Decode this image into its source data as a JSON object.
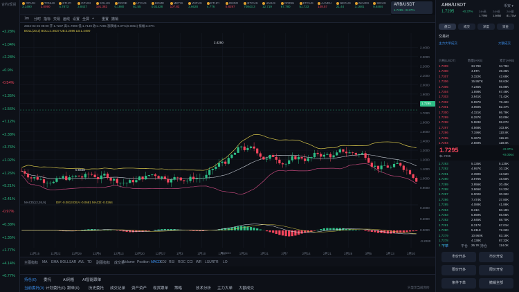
{
  "left_strip": {
    "header": "合约/现货",
    "percents": [
      {
        "v": "+2.28%",
        "dir": "up"
      },
      {
        "v": "+1.04%",
        "dir": "up"
      },
      {
        "v": "+2.28%",
        "dir": "up"
      },
      {
        "v": "+0.9%",
        "dir": "up"
      },
      {
        "v": "-0.54%",
        "dir": "dn"
      },
      {
        "v": "+1.35%",
        "dir": "up"
      },
      {
        "v": "+1.56%",
        "dir": "up"
      },
      {
        "v": "+7.12%",
        "dir": "up"
      },
      {
        "v": "+2.38%",
        "dir": "up"
      },
      {
        "v": "+3.76%",
        "dir": "up"
      },
      {
        "v": "+1.02%",
        "dir": "up"
      },
      {
        "v": "+1.26%",
        "dir": "up"
      },
      {
        "v": "+5.21%",
        "dir": "up"
      },
      {
        "v": "+2.41%",
        "dir": "up"
      },
      {
        "v": "-0.97%",
        "dir": "dn"
      },
      {
        "v": "+0.38%",
        "dir": "up"
      },
      {
        "v": "+1.35%",
        "dir": "up"
      },
      {
        "v": "+1.77%",
        "dir": "up"
      },
      {
        "v": "+4.14%",
        "dir": "up"
      },
      {
        "v": "+0.77%",
        "dir": "up"
      }
    ]
  },
  "tickers": [
    {
      "name": "OPUSI",
      "price": "3.1490",
      "chg": "+1.23",
      "dir": "up"
    },
    {
      "name": "TONUS",
      "price": "3.0090",
      "chg": "-0.4",
      "dir": "dn"
    },
    {
      "name": "ETHFI",
      "price": "4.7873",
      "chg": "7.2",
      "dir": "up"
    },
    {
      "name": "OPUSI",
      "price": "3.8427",
      "chg": "2.2",
      "dir": "up"
    },
    {
      "name": "SOLUS",
      "price": "191.382",
      "chg": "-1.2",
      "dir": "dn"
    },
    {
      "name": "DOGE",
      "price": "0.1980",
      "chg": "1.7",
      "dir": "up"
    },
    {
      "name": "LTCUS",
      "price": "81.55",
      "chg": "0.8",
      "dir": "up"
    },
    {
      "name": "BOME",
      "price": "0.01428",
      "chg": "1.2",
      "dir": "up"
    },
    {
      "name": "METIS",
      "price": "107.82",
      "chg": "-0.1",
      "dir": "dn"
    },
    {
      "name": "WIFUS",
      "price": "3.6628",
      "chg": "2.4",
      "dir": "up"
    },
    {
      "name": "ETHFI",
      "price": "4.776",
      "chg": "7.19",
      "dir": "up"
    },
    {
      "name": "ONDO",
      "price": "0.8297",
      "chg": "-0.3",
      "dir": "dn"
    },
    {
      "name": "BTCUS",
      "price": "70843.3",
      "chg": "0.5",
      "dir": "up"
    },
    {
      "name": "UNIUS",
      "price": "12.719",
      "chg": "0.2",
      "dir": "up"
    },
    {
      "name": "ORDIU",
      "price": "67.780",
      "chg": "1.9",
      "dir": "up"
    },
    {
      "name": "ETCUS",
      "price": "51.723",
      "chg": "0.5",
      "dir": "up"
    },
    {
      "name": "AAVEU",
      "price": "108.57",
      "chg": "-0.4",
      "dir": "dn"
    },
    {
      "name": "NEOUS",
      "price": "21.44",
      "chg": "2.1",
      "dir": "up"
    },
    {
      "name": "WAVES",
      "price": "3.1681",
      "chg": "2.3",
      "dir": "up"
    },
    {
      "name": "SEIUS",
      "price": "0.8484",
      "chg": "1.5",
      "dir": "up"
    }
  ],
  "pair_tab": {
    "label": "ARB/USDT",
    "sub": "1.7295 +0.37%"
  },
  "toolbar": {
    "items": [
      "1m",
      "分时",
      "指标",
      "交易",
      "画线",
      "设置",
      "全屏",
      "+",
      "重置",
      "撤销"
    ],
    "ma_line": "2024-03-25 08:00  开:1.7237  高:1.7898  低:1.7149  收:1.7295  涨跌幅:0.37%(0.0064)  振幅:3.37%",
    "boll_line": "BOLL(20,2)  BOLL:1.8537  UB:2.2596  LB:1.4490"
  },
  "chart": {
    "price_axis": [
      "2.4000",
      "2.3000",
      "2.2000",
      "2.1000",
      "2.0000",
      "1.9000",
      "1.8000",
      "1.7000",
      "1.6000",
      "1.5000",
      "1.4000",
      "1.3000",
      "1.2000",
      "1.1000",
      "1.0000",
      "0.9000"
    ],
    "current_price": "1.7295",
    "high_label": "2.4250",
    "low_label": "0.9408",
    "macd_axis": [
      "0.4000",
      "0.2000",
      "0.0000",
      "-0.2000"
    ],
    "macd_label": "MACD(12,26,9)",
    "macd_values": "DIF:-0.0813  DEA:-0.0681  MACD:-0.0264",
    "time_axis": [
      "11月15",
      "11月22",
      "11月29",
      "12月6",
      "12月13",
      "12月20",
      "12月27",
      "1月3",
      "1月10",
      "1月17",
      "1月24",
      "1月31",
      "2月7",
      "2月14",
      "2月21",
      "2月28",
      "3月6",
      "3月13",
      "3月20"
    ],
    "footer_badge": "2024/03"
  },
  "indicator_bar": {
    "items": [
      "主图指标",
      "MA",
      "EMA",
      "BOLL",
      "SAR",
      "AVL",
      "TD",
      "副图指标",
      "成交量",
      "Volume",
      "Position",
      "MACD",
      "KDJ",
      "RSI",
      "ROC",
      "CCI",
      "WR",
      "LSUR",
      "TR",
      "LO"
    ],
    "active": "MACD"
  },
  "bottom_tabs": {
    "top": [
      "持仓(0)",
      "委托",
      "AI网格",
      "AI智能跟单"
    ],
    "bottom": [
      "当前委托(0)",
      "计划委托(0)",
      "跟单(0)",
      "历史委托",
      "成交记录",
      "资产资产",
      "现货跟单",
      "策略",
      "技术分析",
      "主力大单",
      "大额成交"
    ],
    "right_note": "只显示当前合约"
  },
  "right_panel": {
    "pair": "ARB/USDT",
    "price": "1.7295",
    "change": "+0.37%",
    "stats": [
      {
        "label": "24h高",
        "value": "1.7990"
      },
      {
        "label": "24h低",
        "value": "1.6950"
      },
      {
        "label": "24h量",
        "value": "81.71M"
      }
    ],
    "subtabs": [
      "盘口",
      "成交",
      "深度",
      "资金"
    ],
    "section_title": "交易对",
    "summary_left": "主力大单成交",
    "summary_right": "大额成交",
    "ob_header": [
      "价格(USDT)",
      "数量(ARB)",
      "累计(ARB)"
    ],
    "asks": [
      [
        "1.7309",
        "34.79K",
        "34.79K"
      ],
      [
        "1.7308",
        "4.5TK",
        "39.36K"
      ],
      [
        "1.7307",
        "3.322K",
        "42.68K"
      ],
      [
        "1.7306",
        "15.95TK",
        "58.63K"
      ],
      [
        "1.7305",
        "7.245K",
        "65.88K"
      ],
      [
        "1.7304",
        "1.598K",
        "67.48K"
      ],
      [
        "1.7303",
        "3.941K",
        "71.42K"
      ],
      [
        "1.7302",
        "6.997K",
        "78.42K"
      ],
      [
        "1.7301",
        "4.050K",
        "82.47K"
      ],
      [
        "1.7300",
        "4.321K",
        "86.79K"
      ],
      [
        "1.7299",
        "6.297K",
        "93.09K"
      ],
      [
        "1.7298",
        "5.983K",
        "99.07K"
      ],
      [
        "1.7297",
        "4.568K",
        "103.6K"
      ],
      [
        "1.7296",
        "7.196K",
        "110.8K"
      ],
      [
        "1.7295",
        "5.367K",
        "116.2K"
      ],
      [
        "1.7294",
        "2.569K",
        "118.8K"
      ]
    ],
    "last_price": "1.7295",
    "last_sub": "$1.7295",
    "last_change": "+0.37%",
    "last_amount": "+0.0064",
    "bids": [
      [
        "1.7293",
        "5.135K",
        "5.135K"
      ],
      [
        "1.7292",
        "4.997K",
        "10.13K"
      ],
      [
        "1.7291",
        "2.390K",
        "12.52K"
      ],
      [
        "1.7290",
        "3.976K",
        "16.50K"
      ],
      [
        "1.7289",
        "3.956K",
        "20.45K"
      ],
      [
        "1.7288",
        "3.866K",
        "24.32K"
      ],
      [
        "1.7287",
        "6.002K",
        "30.32K"
      ],
      [
        "1.7286",
        "7.474K",
        "37.80K"
      ],
      [
        "1.7285",
        "4.088K",
        "41.88K"
      ],
      [
        "1.7284",
        "8.31K",
        "50.19K"
      ],
      [
        "1.7283",
        "5.859K",
        "56.05K"
      ],
      [
        "1.7282",
        "2.645K",
        "58.70K"
      ],
      [
        "1.7281",
        "8.317K",
        "67.01K"
      ],
      [
        "1.7280",
        "5.211K",
        "72.22K"
      ],
      [
        "1.7279",
        "10.960K",
        "83.18K"
      ],
      [
        "1.7278",
        "4.138K",
        "87.32K"
      ],
      [
        "1.7277",
        "26.7K",
        "114.0K"
      ]
    ],
    "bottom_tabs": [
      "下单",
      "平仓",
      "持仓"
    ],
    "buttons": [
      "市价开多",
      "市价开空",
      "限价开多",
      "限价开空",
      "条件下单",
      "撤销全部"
    ]
  }
}
